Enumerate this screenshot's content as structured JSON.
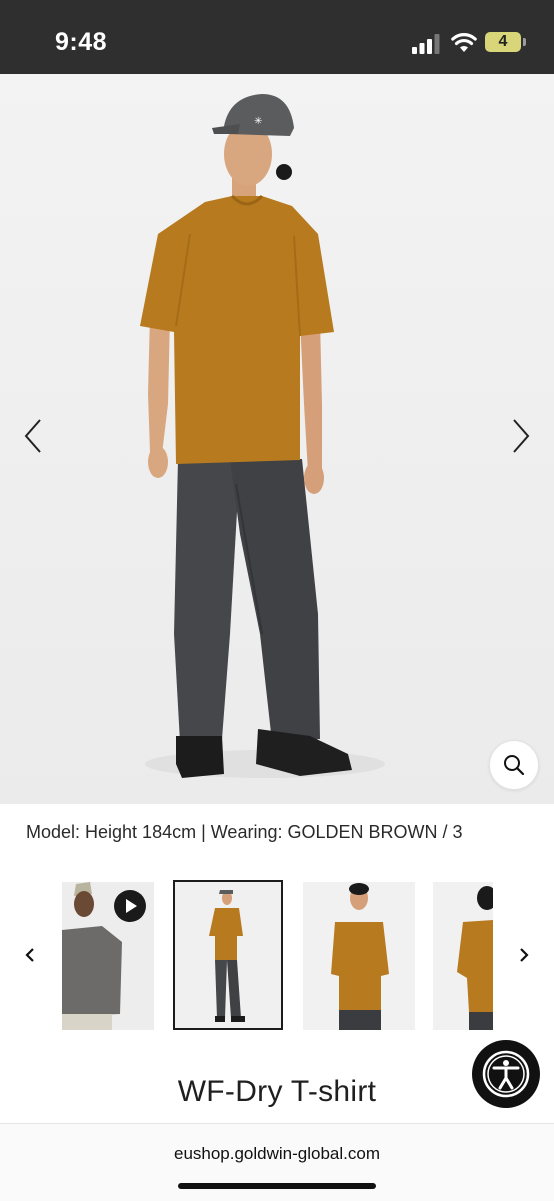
{
  "status_bar": {
    "time": "9:48",
    "battery_level": "4",
    "icons": [
      "cellular-signal-icon",
      "wifi-icon",
      "battery-icon"
    ]
  },
  "gallery": {
    "main_image_alt": "Model wearing golden brown t-shirt and grey trousers",
    "icons": [
      "chevron-left-icon",
      "chevron-right-icon",
      "zoom-magnifier-icon"
    ]
  },
  "caption": "Model: Height 184cm | Wearing: GOLDEN BROWN / 3",
  "thumbnails": {
    "selected_index": 1,
    "items": [
      {
        "alt": "Video: model in grey t-shirt",
        "has_video": true
      },
      {
        "alt": "Full body front view",
        "has_video": false
      },
      {
        "alt": "Upper body front view",
        "has_video": false
      },
      {
        "alt": "Upper body side view",
        "has_video": false
      }
    ]
  },
  "product": {
    "title": "WF-Dry T-shirt"
  },
  "accessibility_button_icon": "accessibility-person-icon",
  "browser": {
    "url": "eushop.goldwin-global.com"
  },
  "colors": {
    "shirt": "#B87A1E",
    "trousers": "#45474a",
    "status_bar_bg": "#2f2f2f"
  }
}
